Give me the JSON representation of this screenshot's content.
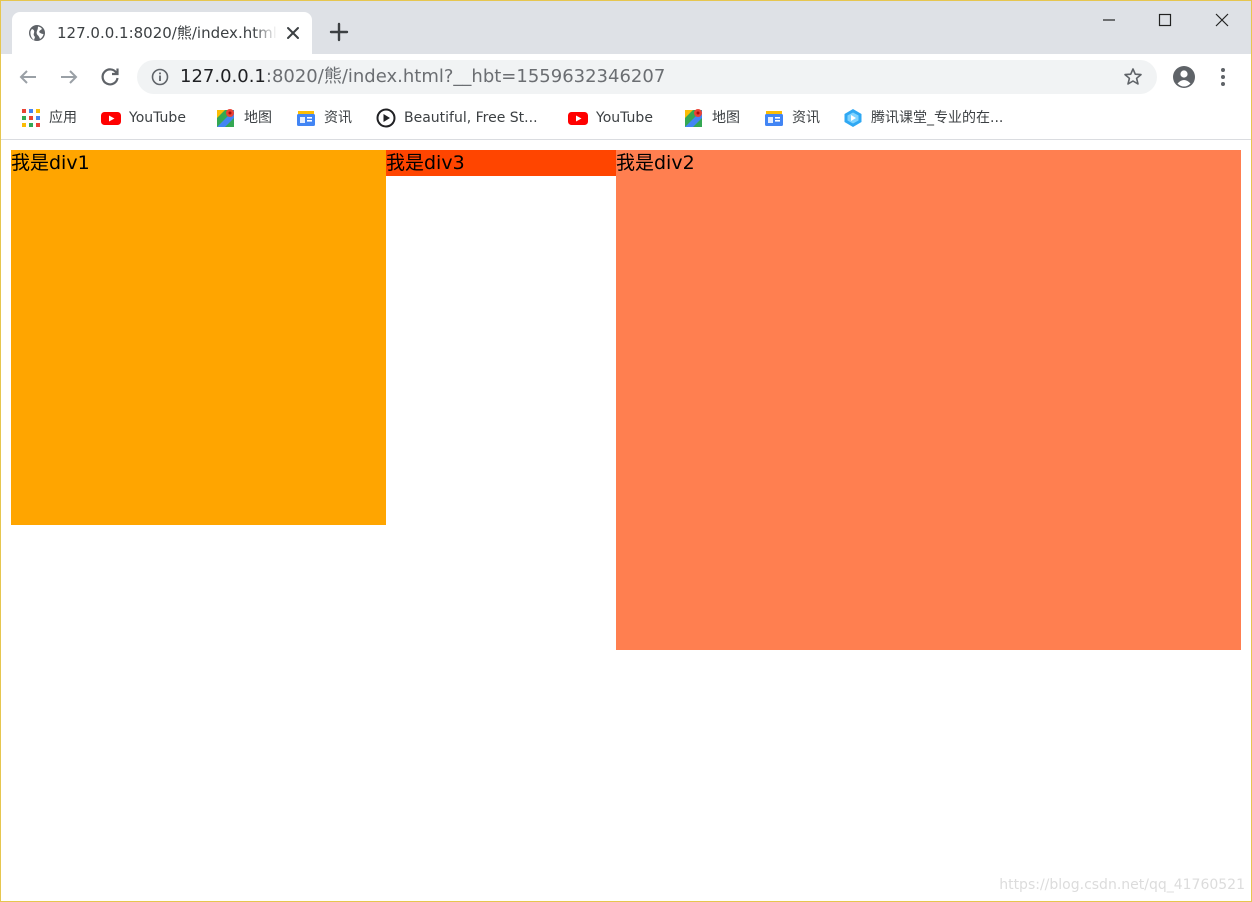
{
  "tab": {
    "title": "127.0.0.1:8020/熊/index.html?__hbt=1559632346207"
  },
  "address_bar": {
    "host": "127.0.0.1",
    "rest": ":8020/熊/index.html?__hbt=1559632346207"
  },
  "bookmarks": [
    {
      "label": "应用",
      "icon": "apps-grid-icon"
    },
    {
      "label": "YouTube",
      "icon": "youtube-icon"
    },
    {
      "label": "地图",
      "icon": "maps-icon"
    },
    {
      "label": "资讯",
      "icon": "news-icon"
    },
    {
      "label": "Beautiful, Free St...",
      "icon": "play-circle-icon"
    },
    {
      "label": "YouTube",
      "icon": "youtube-icon"
    },
    {
      "label": "地图",
      "icon": "maps-icon"
    },
    {
      "label": "资讯",
      "icon": "news-icon"
    },
    {
      "label": "腾讯课堂_专业的在...",
      "icon": "tencent-classroom-icon"
    }
  ],
  "page": {
    "div1": {
      "text": "我是div1",
      "color": "#ffa500"
    },
    "div3": {
      "text": "我是div3",
      "color": "#ff4500"
    },
    "div2": {
      "text": "我是div2",
      "color": "#ff7f50"
    }
  },
  "watermark": "https://blog.csdn.net/qq_41760521"
}
